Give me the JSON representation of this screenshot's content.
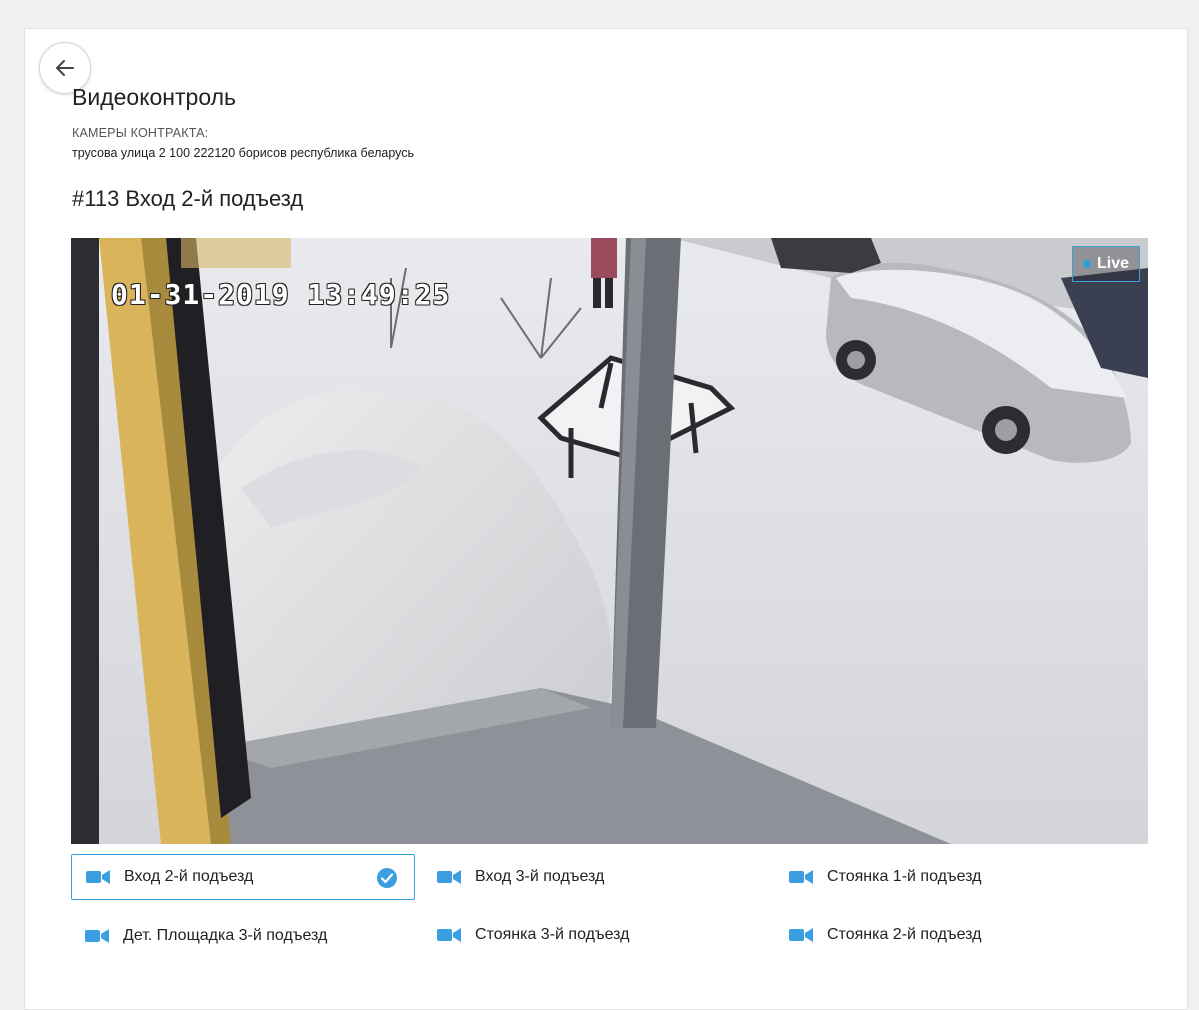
{
  "header": {
    "title": "Видеоконтроль",
    "section_label": "КАМЕРЫ КОНТРАКТА:",
    "address": "трусова улица 2 100 222120 борисов республика беларусь"
  },
  "camera": {
    "title": "#113 Вход 2-й подъезд",
    "timestamp": "01-31-2019 13:49:25",
    "live_label": "Live"
  },
  "cameras": [
    {
      "label": "Вход 2-й подъезд",
      "selected": true
    },
    {
      "label": "Вход 3-й подъезд",
      "selected": false
    },
    {
      "label": "Стоянка 1-й подъезд",
      "selected": false
    },
    {
      "label": "Дет. Площадка 3-й подъезд",
      "selected": false
    },
    {
      "label": "Стоянка 3-й подъезд",
      "selected": false
    },
    {
      "label": "Стоянка 2-й подъезд",
      "selected": false
    }
  ],
  "colors": {
    "accent": "#3a9ee0",
    "camera_icon": "#3a9ee0"
  },
  "icons": {
    "back": "arrow-left-icon",
    "camera": "video-camera-icon",
    "selected": "check-circle-icon"
  }
}
